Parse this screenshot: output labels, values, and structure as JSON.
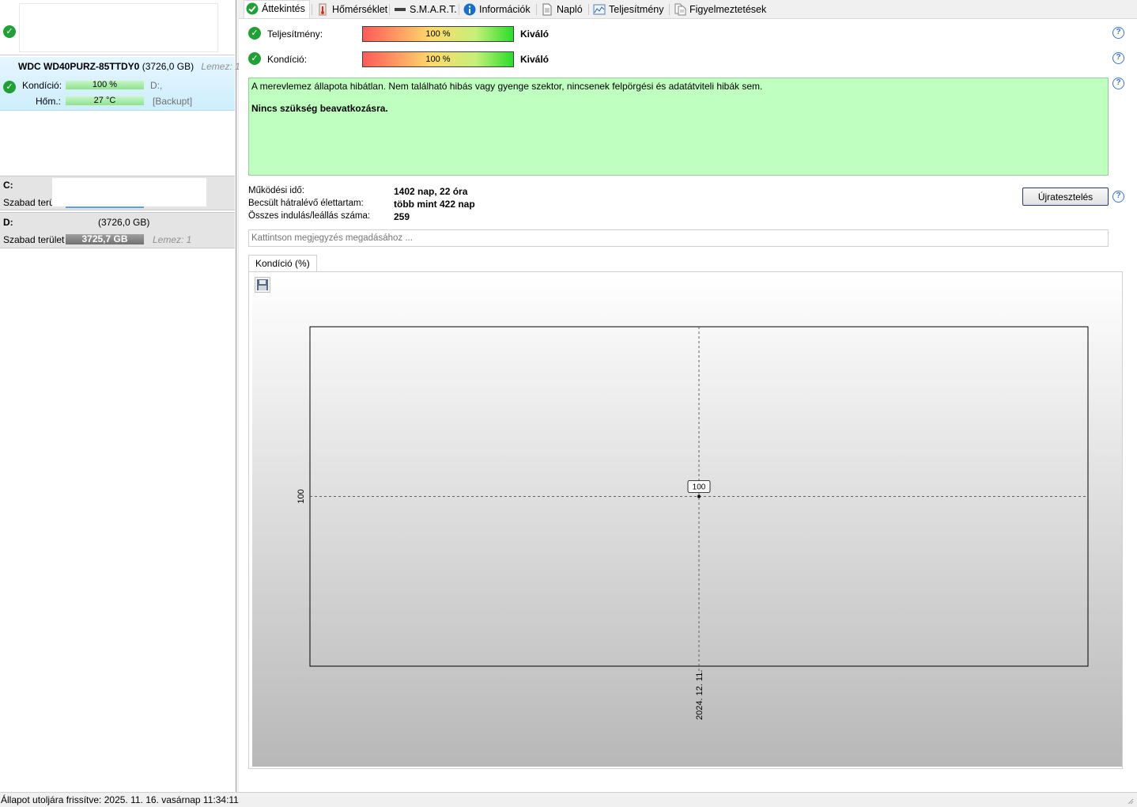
{
  "left": {
    "disk1": {
      "name": "WDC WD40PURZ-85TTDY0",
      "size": "(3726,0 GB)",
      "disk_num": "Lemez: 1",
      "health_label": "Kondíció:",
      "health_value": "100 %",
      "health_level": 1.0,
      "temp_label": "Hőm.:",
      "temp_value": "27 °C",
      "drive_letters": "D:,",
      "volume_label": "[Backupt]"
    },
    "volumes": [
      {
        "letter": "C:",
        "free_label": "Szabad terü"
      },
      {
        "letter": "D:",
        "size": "(3726,0 GB)",
        "free_label": "Szabad terület",
        "free_value": "3725,7 GB",
        "disk_num": "Lemez: 1"
      }
    ]
  },
  "tabs": [
    {
      "label": "Áttekintés",
      "icon": "check-icon",
      "active": true
    },
    {
      "label": "Hőmérséklet",
      "icon": "thermometer-icon"
    },
    {
      "label": "S.M.A.R.T.",
      "icon": "disk-bar-icon"
    },
    {
      "label": "Információk",
      "icon": "info-icon"
    },
    {
      "label": "Napló",
      "icon": "document-icon"
    },
    {
      "label": "Teljesítmény",
      "icon": "chart-icon"
    },
    {
      "label": "Figyelmeztetések",
      "icon": "alert-document-icon"
    }
  ],
  "overview": {
    "performance_label": "Teljesítmény:",
    "performance_value": "100 %",
    "performance_rating": "Kiváló",
    "health_label": "Kondíció:",
    "health_value": "100 %",
    "health_rating": "Kiváló",
    "status_line1": "A merevlemez állapota hibátlan. Nem található hibás vagy gyenge szektor, nincsenek felpörgési és adatátviteli hibák sem.",
    "status_line2": "Nincs szükség beavatkozásra.",
    "uptime_label": "Működési idő:",
    "uptime_value": "1402 nap, 22 óra",
    "remaining_label": "Becsült hátralévő élettartam:",
    "remaining_value": "több mint 422 nap",
    "startstop_label": "Összes indulás/leállás száma:",
    "startstop_value": "259",
    "retest_button": "Újratesztelés",
    "note_placeholder": "Kattintson megjegyzés megadásához ..."
  },
  "chart_tab_label": "Kondíció  (%)",
  "chart_data": {
    "type": "line",
    "title": "",
    "x": [
      "2024. 12. 11."
    ],
    "series": [
      {
        "values": [
          100
        ]
      }
    ],
    "y_tick_labels": [
      "100"
    ],
    "data_labels": [
      "100"
    ],
    "grid": true
  },
  "statusbar": {
    "text": "Állapot utoljára frissítve: 2025. 11. 16. vasárnap 11:34:11"
  }
}
